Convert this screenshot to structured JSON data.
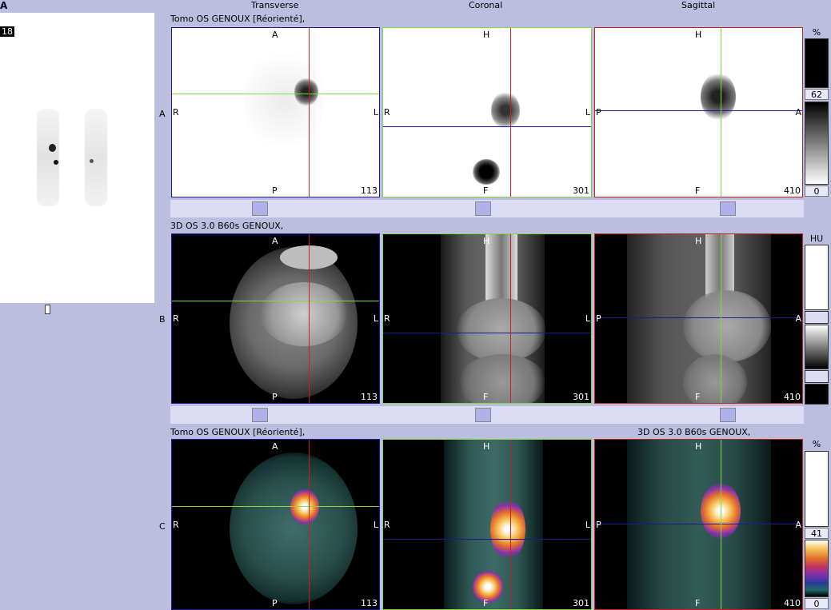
{
  "panel_tag": "A",
  "frame_count": "18",
  "views": {
    "transverse": "Transverse",
    "coronal": "Coronal",
    "sagittal": "Sagittal"
  },
  "rows": {
    "a": {
      "label": "A",
      "title": "Tomo OS GENOUX [Réorienté],",
      "title_right": ""
    },
    "b": {
      "label": "B",
      "title": "3D OS  3.0  B60s GENOUX,",
      "title_right": ""
    },
    "c": {
      "label": "C",
      "title": "Tomo OS GENOUX [Réorienté],",
      "title_right": "3D OS  3.0  B60s GENOUX,"
    }
  },
  "orientation": {
    "transverse": {
      "top": "A",
      "bottom": "P",
      "left": "R",
      "right": "L",
      "slice": "113"
    },
    "coronal": {
      "top": "H",
      "bottom": "F",
      "left": "R",
      "right": "L",
      "slice": "301"
    },
    "sagittal": {
      "top": "H",
      "bottom": "F",
      "left": "P",
      "right": "A",
      "slice": "410"
    }
  },
  "colorbars": {
    "a": {
      "unit": "%",
      "value": "62",
      "min": "0"
    },
    "b": {
      "unit": "HU"
    },
    "c": {
      "unit": "%",
      "value": "41",
      "min": "0"
    }
  },
  "colors": {
    "background": "#bcbedf",
    "crosshair_red": "#c42222",
    "crosshair_green": "#7fdc3a",
    "crosshair_blue": "#1b1b9a"
  }
}
